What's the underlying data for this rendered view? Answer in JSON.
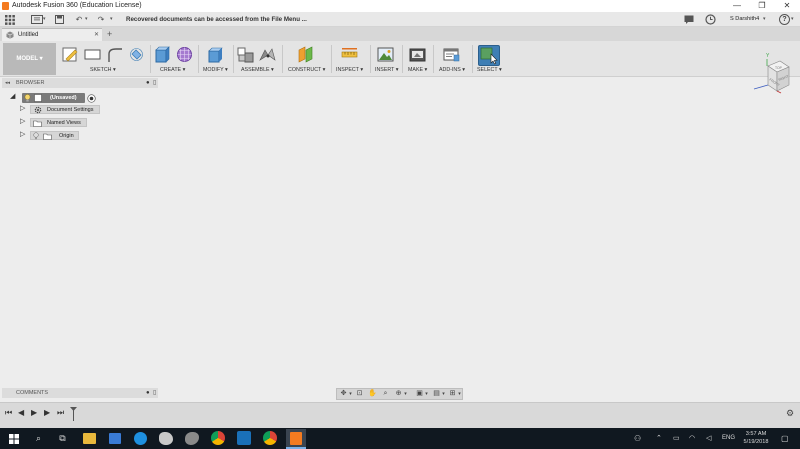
{
  "window": {
    "title": "Autodesk Fusion 360 (Education License)",
    "minimize": "—",
    "restore": "❐",
    "close": "✕"
  },
  "quickbar": {
    "notice": "Recovered documents can be accessed from the File Menu ...",
    "user": "S Darshith4",
    "help": "?"
  },
  "tab": {
    "name": "Untitled",
    "close": "✕",
    "new": "+"
  },
  "toolbar": {
    "workspace": "MODEL",
    "groups": {
      "sketch": "SKETCH ▾",
      "create": "CREATE ▾",
      "modify": "MODIFY ▾",
      "assemble": "ASSEMBLE ▾",
      "construct": "CONSTRUCT ▾",
      "inspect": "INSPECT ▾",
      "insert": "INSERT ▾",
      "make": "MAKE ▾",
      "addins": "ADD-INS ▾",
      "select": "SELECT ▾"
    }
  },
  "browser": {
    "header": "BROWSER",
    "root": "(Unsaved)",
    "items": [
      {
        "label": "Document Settings"
      },
      {
        "label": "Named Views"
      },
      {
        "label": "Origin"
      }
    ]
  },
  "comments": {
    "header": "COMMENTS"
  },
  "viewcube": {
    "top": "TOP",
    "front": "FRONT",
    "right": "RIGHT",
    "axis_y": "Y",
    "axis_z": "Z",
    "axis_x": "X"
  },
  "taskbar": {
    "language": "ENG",
    "time": "3:57 AM",
    "date": "5/19/2018"
  },
  "colors": {
    "accent_orange": "#f47b20",
    "select_blue": "#3f7fb5",
    "taskbar": "#101820"
  }
}
